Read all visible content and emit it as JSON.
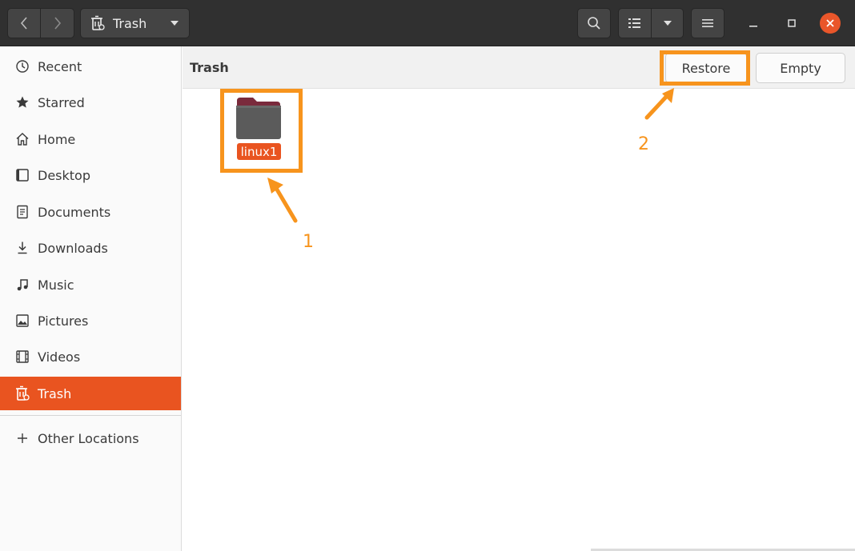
{
  "header": {
    "location_label": "Trash"
  },
  "sidebar": {
    "items": [
      {
        "label": "Recent",
        "icon": "clock-icon"
      },
      {
        "label": "Starred",
        "icon": "star-icon"
      },
      {
        "label": "Home",
        "icon": "home-icon"
      },
      {
        "label": "Desktop",
        "icon": "desktop-icon"
      },
      {
        "label": "Documents",
        "icon": "document-icon"
      },
      {
        "label": "Downloads",
        "icon": "download-icon"
      },
      {
        "label": "Music",
        "icon": "music-icon"
      },
      {
        "label": "Pictures",
        "icon": "picture-icon"
      },
      {
        "label": "Videos",
        "icon": "video-icon"
      },
      {
        "label": "Trash",
        "icon": "trash-icon",
        "active": true
      }
    ],
    "other_locations": "Other Locations"
  },
  "main": {
    "title": "Trash",
    "restore_label": "Restore",
    "empty_label": "Empty",
    "files": [
      {
        "name": "linux1",
        "type": "folder",
        "selected": true
      }
    ]
  },
  "annotations": {
    "label_1": "1",
    "label_2": "2"
  },
  "colors": {
    "accent": "#e95420",
    "annotation": "#f7941d",
    "headerbar": "#303030"
  }
}
